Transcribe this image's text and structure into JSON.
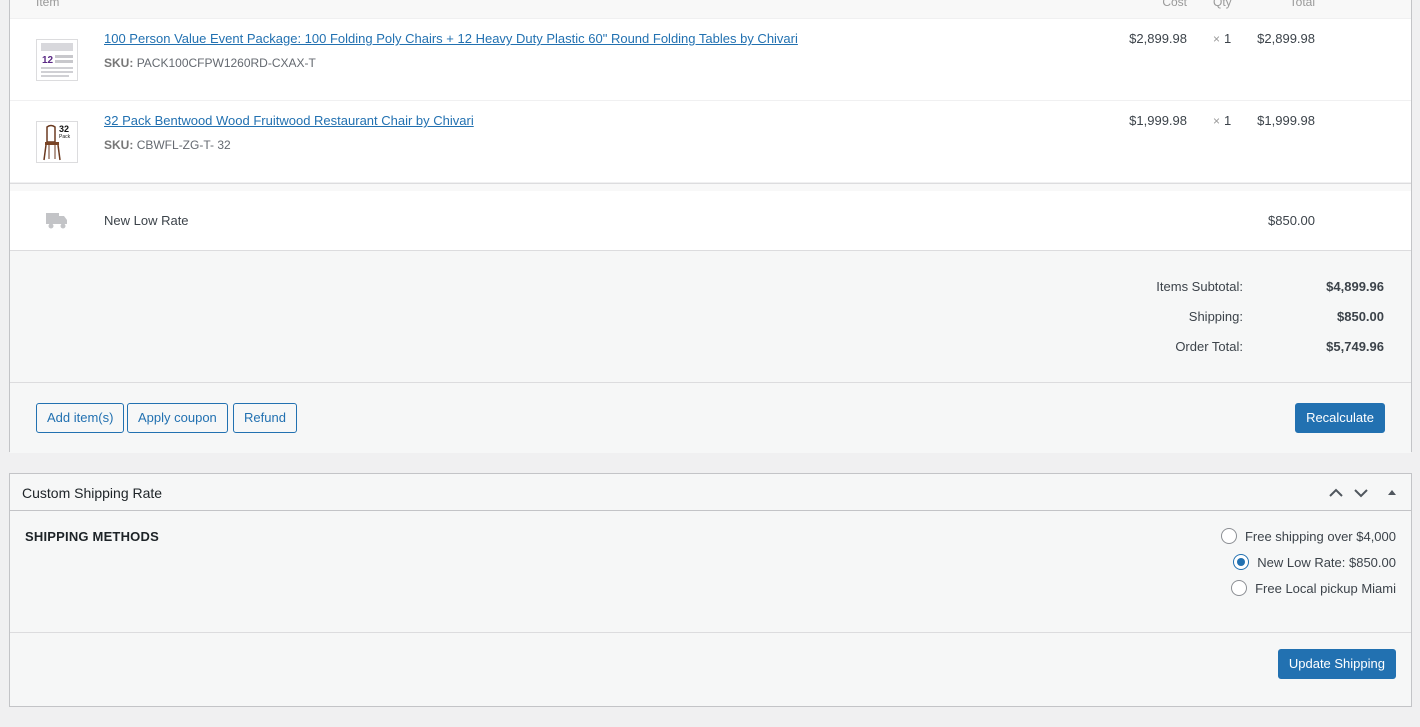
{
  "columns": {
    "item": "Item",
    "cost": "Cost",
    "qty": "Qty",
    "total": "Total"
  },
  "items": [
    {
      "name": "100 Person Value Event Package: 100 Folding Poly Chairs + 12 Heavy Duty Plastic 60\" Round Folding Tables by Chivari",
      "sku_label": "SKU:",
      "sku": "PACK100CFPW1260RD-CXAX-T",
      "cost": "$2,899.98",
      "qty_symbol": "×",
      "qty": "1",
      "total": "$2,899.98"
    },
    {
      "name": "32 Pack Bentwood Wood Fruitwood Restaurant Chair by Chivari",
      "sku_label": "SKU:",
      "sku": "CBWFL-ZG-T- 32",
      "cost": "$1,999.98",
      "qty_symbol": "×",
      "qty": "1",
      "total": "$1,999.98"
    }
  ],
  "shipping_line": {
    "icon": "truck-icon",
    "name": "New Low Rate",
    "total": "$850.00"
  },
  "totals": {
    "subtotal_label": "Items Subtotal:",
    "subtotal": "$4,899.96",
    "shipping_label": "Shipping:",
    "shipping": "$850.00",
    "order_total_label": "Order Total:",
    "order_total": "$5,749.96"
  },
  "actions": {
    "add_items": "Add item(s)",
    "apply_coupon": "Apply coupon",
    "refund": "Refund",
    "recalculate": "Recalculate"
  },
  "custom_shipping": {
    "title": "Custom Shipping Rate",
    "section_title": "SHIPPING METHODS",
    "options": [
      {
        "label": "Free shipping over $4,000",
        "checked": false
      },
      {
        "label": "New Low Rate: $850.00",
        "checked": true
      },
      {
        "label": "Free Local pickup Miami",
        "checked": false
      }
    ],
    "update_button": "Update Shipping"
  },
  "colors": {
    "accent": "#2271b1",
    "text": "#3c434a",
    "page_bg": "#f0f0f1"
  }
}
